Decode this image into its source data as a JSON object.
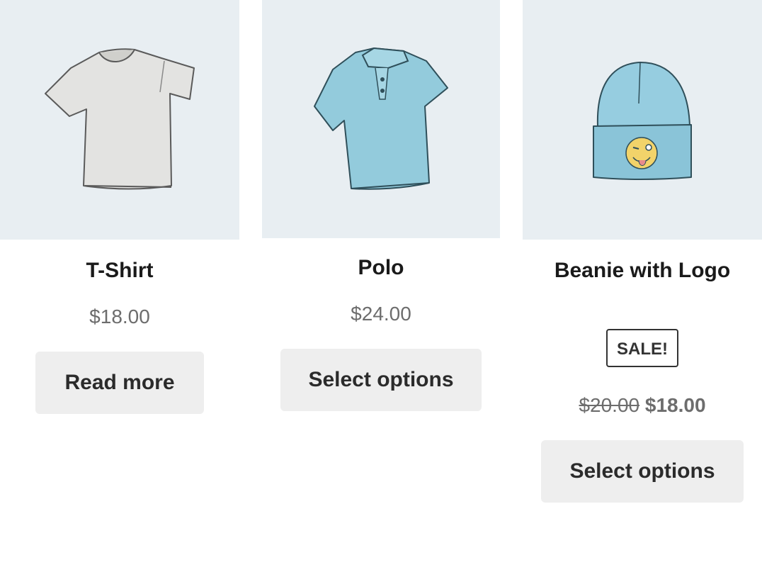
{
  "products": [
    {
      "title": "T-Shirt",
      "price": "$18.00",
      "button": "Read more",
      "image_icon": "t-shirt-icon",
      "image_color": "#e3e3e1"
    },
    {
      "title": "Polo",
      "price": "$24.00",
      "button": "Select options",
      "image_icon": "polo-shirt-icon",
      "image_color": "#93cbdc"
    },
    {
      "title": "Beanie with Logo",
      "sale_badge": "SALE!",
      "price_old": "$20.00",
      "price_new": "$18.00",
      "button": "Select options",
      "image_icon": "beanie-icon",
      "image_color": "#96cde0"
    }
  ],
  "colors": {
    "thumbnail_bg": "#e8eef2",
    "button_bg": "#eeeeee",
    "price_text": "#6d6d6d"
  }
}
